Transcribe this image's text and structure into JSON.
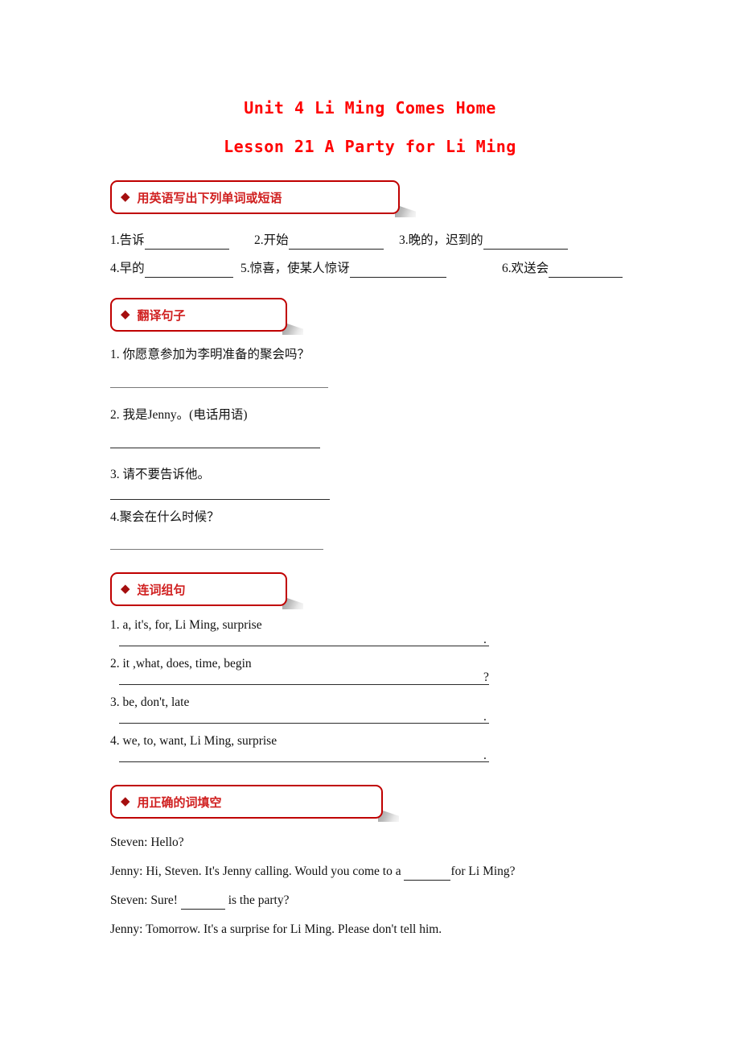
{
  "document": {
    "unit_title": "Unit 4 Li Ming Comes Home",
    "lesson_title": "Lesson 21 A Party for Li Ming",
    "title_color": "#FF0000",
    "section_border_color": "#C00000",
    "section_label_color": "#D02020",
    "diamond_color": "#A50E0E",
    "diamond_glyph": "◆"
  },
  "sections": [
    {
      "id": "write-in-english",
      "label": "用英语写出下列单词或短语",
      "rows": [
        {
          "items": [
            {
              "text": "1.告诉",
              "blank_width": 105
            },
            {
              "text": "2.开始",
              "blank_width": 118
            },
            {
              "text": "3.晚的，迟到的",
              "blank_width": 105
            }
          ]
        },
        {
          "items": [
            {
              "text": "4.早的",
              "blank_width": 110
            },
            {
              "text": "5.惊喜，使某人惊讶",
              "blank_width": 120
            },
            {
              "text": "6.欢送会",
              "blank_width": 92
            }
          ]
        }
      ]
    },
    {
      "id": "translate-sentences",
      "label": "翻译句子",
      "questions": [
        {
          "prompt": "1. 你愿意参加为李明准备的聚会吗？"
        },
        {
          "prompt": "2. 我是Jenny。(电话用语)"
        },
        {
          "prompt": "3. 请不要告诉他。"
        },
        {
          "prompt": "4.聚会在什么时候？"
        }
      ]
    },
    {
      "id": "word-order",
      "label": "连词组句",
      "questions": [
        {
          "prompt": "1. a, it's, for, Li Ming, surprise",
          "end_punct": "."
        },
        {
          "prompt": "2. it ,what, does, time, begin",
          "end_punct": "?"
        },
        {
          "prompt": "3. be, don't, late",
          "end_punct": "."
        },
        {
          "prompt": "4. we, to, want, Li Ming, surprise",
          "end_punct": "."
        }
      ]
    },
    {
      "id": "fill-in-correct-word",
      "label": "用正确的词填空",
      "dialogue": [
        {
          "speaker_line": "Steven: Hello?"
        },
        {
          "speaker_line_parts": [
            "Jenny: Hi, Steven. It's Jenny calling. Would you come to a ",
            "for Li Ming?"
          ],
          "blank_width": 58
        },
        {
          "speaker_line_parts": [
            "Steven: Sure! ",
            " is the party?"
          ],
          "blank_width": 55
        },
        {
          "speaker_line": "Jenny: Tomorrow. It's a surprise for Li Ming. Please don't tell him."
        }
      ]
    }
  ]
}
